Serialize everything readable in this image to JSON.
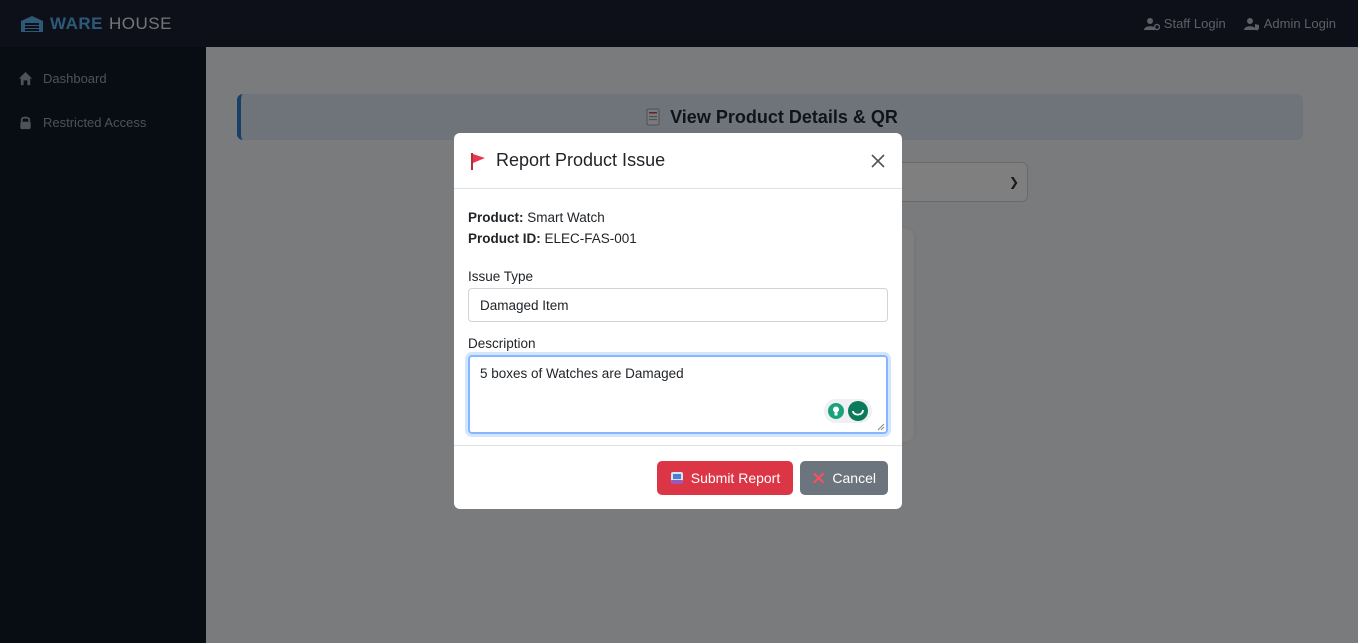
{
  "navbar": {
    "brand_bold": "WARE",
    "brand_rest": "HOUSE",
    "staff_login": "Staff Login",
    "admin_login": "Admin Login"
  },
  "sidebar": {
    "items": [
      {
        "label": "Dashboard",
        "icon": "home-icon"
      },
      {
        "label": "Restricted Access",
        "icon": "lock-icon"
      }
    ]
  },
  "main": {
    "header_title": "View Product Details & QR"
  },
  "modal": {
    "title": "Report Product Issue",
    "product_label": "Product:",
    "product_value": "Smart Watch",
    "product_id_label": "Product ID:",
    "product_id_value": "ELEC-FAS-001",
    "issue_type_label": "Issue Type",
    "issue_type_value": "Damaged Item",
    "description_label": "Description",
    "description_value": "5 boxes of Watches are Damaged",
    "submit_label": "Submit Report",
    "cancel_label": "Cancel"
  },
  "colors": {
    "navbar_bg": "#1b2133",
    "sidebar_bg": "#111827",
    "brand_accent": "#5ab3f0",
    "danger": "#dc3545",
    "secondary": "#6c757d",
    "flag": "#e63950"
  }
}
